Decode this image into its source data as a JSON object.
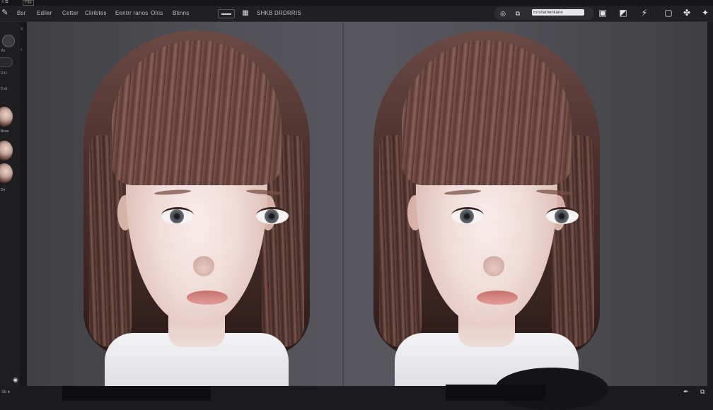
{
  "window": {
    "tiny_left": "≡ ⧉",
    "tiny_box": "File"
  },
  "menubar": {
    "items": [
      "Bsr",
      "Ediler",
      "Cetter",
      "Cliribtes",
      "Eentrr ranos",
      "Olris",
      "Btinns",
      "SHKB DRDRRIS"
    ],
    "boxed_label": "▬▬"
  },
  "search": {
    "value": "Enshamenitane"
  },
  "sidebar": {
    "labels": [
      "Vu",
      "D.U",
      "D.al",
      "Beoe",
      "De"
    ]
  },
  "bottombar": {
    "label": "Sb ⏵"
  },
  "icons": {
    "brush": "brush-icon",
    "target": "target-icon",
    "save": "save-icon",
    "export": "export-icon",
    "magic": "magic-icon",
    "frame": "frame-icon",
    "settings": "settings-icon"
  }
}
